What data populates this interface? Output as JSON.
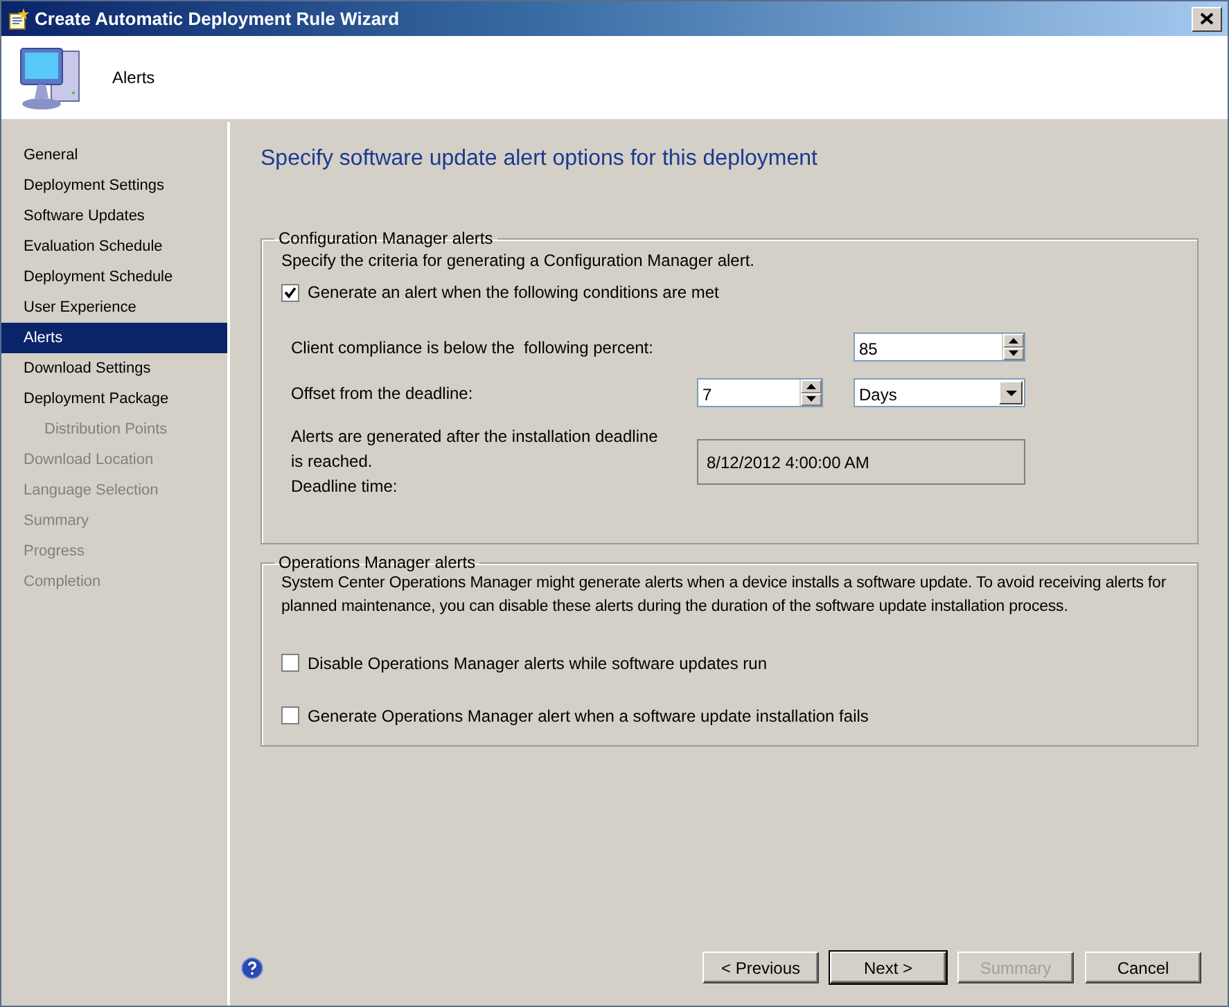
{
  "window": {
    "title": "Create Automatic Deployment Rule Wizard"
  },
  "header": {
    "title": "Alerts"
  },
  "nav": [
    {
      "label": "General",
      "selected": false,
      "disabled": false
    },
    {
      "label": "Deployment Settings",
      "selected": false,
      "disabled": false
    },
    {
      "label": "Software Updates",
      "selected": false,
      "disabled": false
    },
    {
      "label": "Evaluation Schedule",
      "selected": false,
      "disabled": false
    },
    {
      "label": "Deployment Schedule",
      "selected": false,
      "disabled": false
    },
    {
      "label": "User Experience",
      "selected": false,
      "disabled": false
    },
    {
      "label": "Alerts",
      "selected": true,
      "disabled": false
    },
    {
      "label": "Download Settings",
      "selected": false,
      "disabled": false
    },
    {
      "label": "Deployment Package",
      "selected": false,
      "disabled": false,
      "children": [
        {
          "label": "Distribution Points",
          "selected": false,
          "disabled": true
        }
      ]
    },
    {
      "label": "Download Location",
      "selected": false,
      "disabled": true
    },
    {
      "label": "Language Selection",
      "selected": false,
      "disabled": true
    },
    {
      "label": "Summary",
      "selected": false,
      "disabled": true
    },
    {
      "label": "Progress",
      "selected": false,
      "disabled": true
    },
    {
      "label": "Completion",
      "selected": false,
      "disabled": true
    }
  ],
  "page_title": "Specify software update alert options for this deployment",
  "config_alerts": {
    "legend": "Configuration Manager alerts",
    "description": "Specify the criteria for generating a Configuration Manager alert.",
    "generate_alert": {
      "label": "Generate an alert when the following conditions are met",
      "checked": true
    },
    "compliance": {
      "label": "Client compliance is below the  following percent:",
      "value": "85"
    },
    "offset": {
      "label": "Offset from the deadline:",
      "value": "7",
      "unit": "Days"
    },
    "deadline": {
      "label": "Alerts are generated after the installation deadline is reached.",
      "label_2": "Deadline time:",
      "value": "8/12/2012 4:00:00 AM"
    }
  },
  "ops_alerts": {
    "legend": "Operations Manager alerts",
    "description": "System Center Operations Manager might generate alerts when a device installs a software update. To avoid receiving alerts for planned maintenance, you can disable these alerts during the duration of the software update installation process.",
    "options": [
      {
        "label": "Disable Operations Manager alerts while software updates run",
        "checked": false
      },
      {
        "label": "Generate Operations Manager alert when a software update installation fails",
        "checked": false
      }
    ]
  },
  "buttons": [
    {
      "label": "< Previous",
      "default": false,
      "disabled": false
    },
    {
      "label": "Next >",
      "default": true,
      "disabled": false
    },
    {
      "label": "Summary",
      "default": false,
      "disabled": true
    },
    {
      "label": "Cancel",
      "default": false,
      "disabled": false
    }
  ]
}
